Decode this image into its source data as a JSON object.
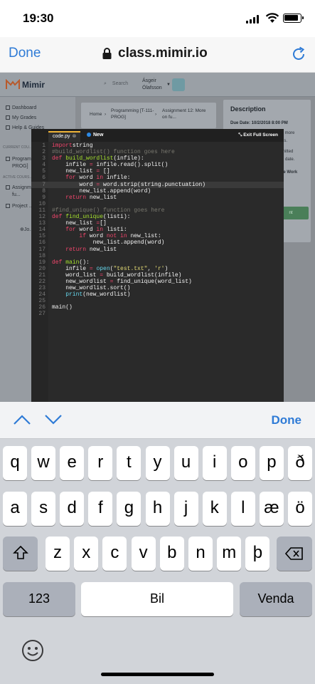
{
  "status": {
    "time": "19:30"
  },
  "browser": {
    "done_label": "Done",
    "url": "class.mimir.io"
  },
  "mimir": {
    "logo_text": "Mimir",
    "search_placeholder": "Search",
    "user_first": "Ásgeir",
    "user_last": "Ólafsson",
    "sidebar": {
      "dashboard": "Dashboard",
      "my_grades": "My Grades",
      "help": "Help & Guides",
      "current_courses": "CURRENT COU...",
      "course_1": "Program...",
      "course_1b": "PROG]",
      "active_courses": "ACTIVE COURS...",
      "assignment": "Assignm...",
      "assignment_b": "fu...",
      "project": "Project ...",
      "join": "⊕Jo..."
    },
    "breadcrumb": {
      "home": "Home",
      "sep": "›",
      "course": "Programming [T-111-",
      "course_b": "PROG]",
      "assignment": "Assignment 12: More",
      "assignment_b": "on fu..."
    },
    "description": {
      "title": "Description",
      "due": "Due Date: 10/2/2018 8:00 PM",
      "t1": "s more",
      "t2": "ns.",
      "t3": "mitted",
      "t4": "e date.",
      "bold": "re Work",
      "green": "nt"
    }
  },
  "editor": {
    "tab": "code.py",
    "new_label": "New",
    "fullscreen": "Exit Full Screen",
    "lines": [
      {
        "n": "1",
        "tokens": [
          [
            "kw",
            "import"
          ],
          [
            "",
            "string"
          ]
        ]
      },
      {
        "n": "2",
        "tokens": [
          [
            "cm",
            "#build_wordlist() function goes here"
          ]
        ]
      },
      {
        "n": "3",
        "tokens": [
          [
            "kw",
            "def"
          ],
          [
            "",
            " "
          ],
          [
            "fn",
            "build_wordlist"
          ],
          [
            "",
            "(infile):"
          ]
        ]
      },
      {
        "n": "4",
        "tokens": [
          [
            "",
            "    infile "
          ],
          [
            "kw",
            "="
          ],
          [
            "",
            " infile.read().split()"
          ]
        ]
      },
      {
        "n": "5",
        "tokens": [
          [
            "",
            "    new_list "
          ],
          [
            "kw",
            "="
          ],
          [
            "",
            " []"
          ]
        ]
      },
      {
        "n": "6",
        "tokens": [
          [
            "",
            "    "
          ],
          [
            "kw",
            "for"
          ],
          [
            "",
            " word "
          ],
          [
            "kw",
            "in"
          ],
          [
            "",
            " infile:"
          ]
        ]
      },
      {
        "n": "7",
        "tokens": [
          [
            "",
            "        word "
          ],
          [
            "kw",
            "="
          ],
          [
            "",
            " word.strip(string.punctuation)"
          ]
        ]
      },
      {
        "n": "8",
        "tokens": [
          [
            "",
            "        new_list.append(word)"
          ]
        ]
      },
      {
        "n": "9",
        "tokens": [
          [
            "",
            "    "
          ],
          [
            "kw",
            "return"
          ],
          [
            "",
            " new_list"
          ]
        ]
      },
      {
        "n": "10",
        "tokens": []
      },
      {
        "n": "11",
        "tokens": [
          [
            "cm",
            "#find_unique() function goes here"
          ]
        ]
      },
      {
        "n": "12",
        "tokens": [
          [
            "kw",
            "def"
          ],
          [
            "",
            " "
          ],
          [
            "fn",
            "find_unique"
          ],
          [
            "",
            "(listi):"
          ]
        ]
      },
      {
        "n": "13",
        "tokens": [
          [
            "",
            "    new_list "
          ],
          [
            "kw",
            "="
          ],
          [
            "",
            "[]"
          ]
        ]
      },
      {
        "n": "14",
        "tokens": [
          [
            "",
            "    "
          ],
          [
            "kw",
            "for"
          ],
          [
            "",
            " word "
          ],
          [
            "kw",
            "in"
          ],
          [
            "",
            " listi:"
          ]
        ]
      },
      {
        "n": "15",
        "tokens": [
          [
            "",
            "        "
          ],
          [
            "kw",
            "if"
          ],
          [
            "",
            " word "
          ],
          [
            "kw",
            "not in"
          ],
          [
            "",
            " new_list:"
          ]
        ]
      },
      {
        "n": "16",
        "tokens": [
          [
            "",
            "            new_list.append(word)"
          ]
        ]
      },
      {
        "n": "17",
        "tokens": [
          [
            "",
            "    "
          ],
          [
            "kw",
            "return"
          ],
          [
            "",
            " new_list"
          ]
        ]
      },
      {
        "n": "18",
        "tokens": []
      },
      {
        "n": "19",
        "tokens": [
          [
            "kw",
            "def"
          ],
          [
            "",
            " "
          ],
          [
            "fn",
            "main"
          ],
          [
            "",
            "():"
          ]
        ]
      },
      {
        "n": "20",
        "tokens": [
          [
            "",
            "    infile "
          ],
          [
            "kw",
            "="
          ],
          [
            "",
            " "
          ],
          [
            "bi",
            "open"
          ],
          [
            "",
            "("
          ],
          [
            "st",
            "\"test.txt\""
          ],
          [
            "",
            ", "
          ],
          [
            "st",
            "'r'"
          ],
          [
            "",
            ")"
          ]
        ]
      },
      {
        "n": "21",
        "tokens": [
          [
            "",
            "    word_list "
          ],
          [
            "kw",
            "="
          ],
          [
            "",
            " build_wordlist(infile)"
          ]
        ]
      },
      {
        "n": "22",
        "tokens": [
          [
            "",
            "    new_wordlist "
          ],
          [
            "kw",
            "="
          ],
          [
            "",
            " find_unique(word_list)"
          ]
        ]
      },
      {
        "n": "23",
        "tokens": [
          [
            "",
            "    new_wordlist.sort()"
          ]
        ]
      },
      {
        "n": "24",
        "tokens": [
          [
            "",
            "    "
          ],
          [
            "bi",
            "print"
          ],
          [
            "",
            "(new_wordlist)"
          ]
        ]
      },
      {
        "n": "25",
        "tokens": []
      },
      {
        "n": "26",
        "tokens": [
          [
            "",
            "main()"
          ]
        ]
      },
      {
        "n": "27",
        "tokens": []
      }
    ]
  },
  "keyboard": {
    "done_label": "Done",
    "row1": [
      "q",
      "w",
      "e",
      "r",
      "t",
      "y",
      "u",
      "i",
      "o",
      "p",
      "ð"
    ],
    "row2": [
      "a",
      "s",
      "d",
      "f",
      "g",
      "h",
      "j",
      "k",
      "l",
      "æ",
      "ö"
    ],
    "row3": [
      "z",
      "x",
      "c",
      "v",
      "b",
      "n",
      "m",
      "þ"
    ],
    "numbers_label": "123",
    "space_label": "Bil",
    "return_label": "Venda"
  }
}
